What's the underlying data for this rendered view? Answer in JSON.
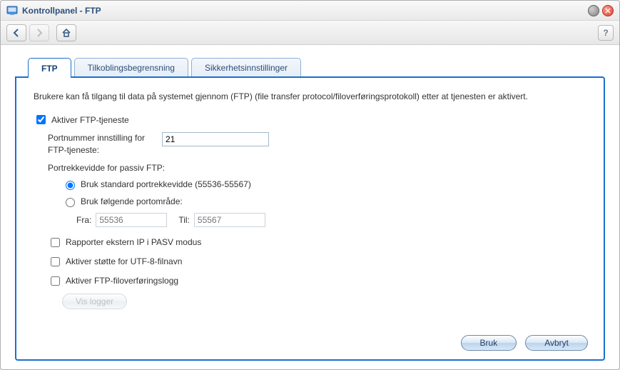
{
  "window": {
    "title": "Kontrollpanel - FTP"
  },
  "tabs": [
    {
      "label": "FTP",
      "active": true
    },
    {
      "label": "Tilkoblingsbegrensning",
      "active": false
    },
    {
      "label": "Sikkerhetsinnstillinger",
      "active": false
    }
  ],
  "panel": {
    "description": "Brukere kan få tilgang til data på systemet gjennom (FTP) (file transfer protocol/filoverføringsprotokoll) etter at tjenesten er aktivert.",
    "enable_ftp": {
      "label": "Aktiver FTP-tjeneste",
      "checked": true
    },
    "port": {
      "label": "Portnummer innstilling for FTP-tjeneste:",
      "value": "21"
    },
    "passive_header": "Portrekkevidde for passiv FTP:",
    "passive_default": {
      "label": "Bruk standard portrekkevidde (55536-55567)",
      "selected": true
    },
    "passive_custom": {
      "label": "Bruk følgende portområde:",
      "selected": false
    },
    "range": {
      "from_label": "Fra:",
      "from_placeholder": "55536",
      "to_label": "Til:",
      "to_placeholder": "55567"
    },
    "report_ip": {
      "label": "Rapporter ekstern IP i PASV modus",
      "checked": false
    },
    "utf8": {
      "label": "Aktiver støtte for UTF-8-filnavn",
      "checked": false
    },
    "xfer_log": {
      "label": "Aktiver FTP-filoverføringslogg",
      "checked": false
    },
    "view_logs": "Vis logger",
    "buttons": {
      "apply": "Bruk",
      "cancel": "Avbryt"
    }
  }
}
